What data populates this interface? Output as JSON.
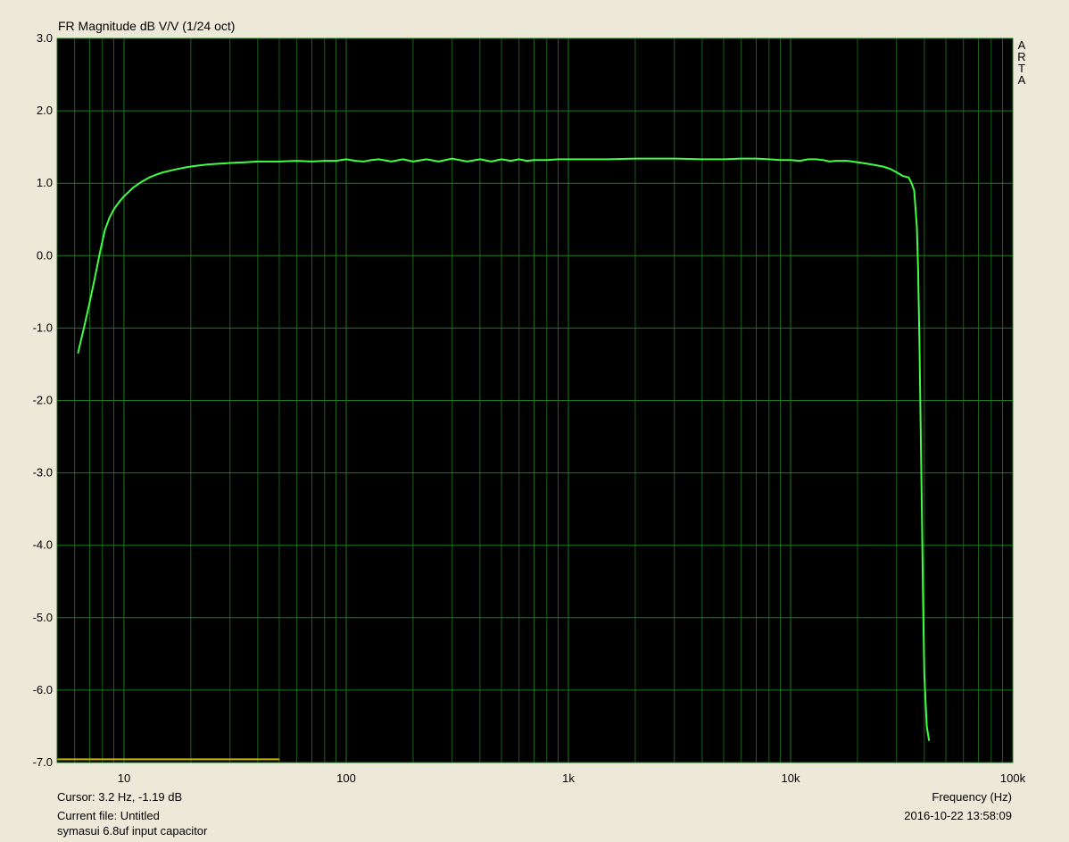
{
  "window": {
    "title": "FR Magnitude dB V/V (1/24 oct)",
    "logo_letters": [
      "A",
      "R",
      "T",
      "A"
    ]
  },
  "status": {
    "cursor": "Cursor: 3.2 Hz, -1.19 dB",
    "current_file": "Current file: Untitled",
    "note": "symasui 6.8uf input capacitor",
    "timestamp": "2016-10-22  13:58:09"
  },
  "colors": {
    "background": "#ece9d8",
    "plot_bg": "#000000",
    "grid": "#1e7a1e",
    "trace": "#40ff40",
    "reference_line": "#c8b400"
  },
  "chart_data": {
    "type": "line",
    "title": "FR Magnitude dB V/V (1/24 oct)",
    "xlabel": "Frequency (Hz)",
    "ylabel": "",
    "xscale": "log",
    "xlim": [
      5,
      100000
    ],
    "ylim": [
      -7,
      3
    ],
    "grid": true,
    "x_ticks": [
      {
        "value": 10,
        "label": "10"
      },
      {
        "value": 100,
        "label": "100"
      },
      {
        "value": 1000,
        "label": "1k"
      },
      {
        "value": 10000,
        "label": "10k"
      },
      {
        "value": 100000,
        "label": "100k"
      }
    ],
    "y_ticks": [
      {
        "value": 3,
        "label": "3.0"
      },
      {
        "value": 2,
        "label": "2.0"
      },
      {
        "value": 1,
        "label": "1.0"
      },
      {
        "value": 0,
        "label": "0.0"
      },
      {
        "value": -1,
        "label": "-1.0"
      },
      {
        "value": -2,
        "label": "-2.0"
      },
      {
        "value": -3,
        "label": "-3.0"
      },
      {
        "value": -4,
        "label": "-4.0"
      },
      {
        "value": -5,
        "label": "-5.0"
      },
      {
        "value": -6,
        "label": "-6.0"
      },
      {
        "value": -7,
        "label": "-7.0"
      }
    ],
    "series": [
      {
        "x": [
          6.2,
          6.6,
          7.0,
          7.4,
          7.8,
          8.2,
          8.6,
          9.0,
          9.5,
          10,
          11,
          12,
          13,
          14,
          15,
          17,
          19,
          21,
          24,
          27,
          30,
          35,
          40,
          50,
          60,
          70,
          80,
          90,
          100,
          110,
          120,
          130,
          140,
          160,
          180,
          200,
          230,
          260,
          300,
          350,
          400,
          450,
          500,
          550,
          600,
          650,
          700,
          800,
          900,
          1000,
          1200,
          1500,
          2000,
          3000,
          4000,
          5000,
          6000,
          7000,
          8000,
          9000,
          10000,
          11000,
          12000,
          13000,
          14000,
          15000,
          16000,
          18000,
          20000,
          22000,
          24000,
          26000,
          28000,
          30000,
          32000,
          34000,
          35000,
          36000,
          37000,
          37500,
          38000,
          38500,
          39000,
          39500,
          40000,
          41000,
          42000
        ],
        "y": [
          -1.35,
          -1.0,
          -0.65,
          -0.3,
          0.05,
          0.35,
          0.52,
          0.64,
          0.74,
          0.82,
          0.94,
          1.02,
          1.08,
          1.12,
          1.15,
          1.19,
          1.22,
          1.24,
          1.26,
          1.27,
          1.28,
          1.29,
          1.3,
          1.3,
          1.31,
          1.3,
          1.31,
          1.31,
          1.33,
          1.31,
          1.3,
          1.32,
          1.33,
          1.3,
          1.33,
          1.3,
          1.33,
          1.3,
          1.34,
          1.3,
          1.33,
          1.3,
          1.33,
          1.31,
          1.33,
          1.31,
          1.32,
          1.32,
          1.33,
          1.33,
          1.33,
          1.33,
          1.34,
          1.34,
          1.33,
          1.33,
          1.34,
          1.34,
          1.33,
          1.32,
          1.32,
          1.31,
          1.33,
          1.33,
          1.32,
          1.3,
          1.31,
          1.31,
          1.29,
          1.27,
          1.25,
          1.23,
          1.2,
          1.15,
          1.1,
          1.08,
          1.0,
          0.9,
          0.4,
          -0.2,
          -1.2,
          -2.4,
          -3.6,
          -4.8,
          -5.8,
          -6.5,
          -6.7
        ]
      }
    ],
    "reference_line": {
      "x": [
        5,
        50
      ],
      "y": [
        -6.98,
        -6.98
      ]
    }
  }
}
